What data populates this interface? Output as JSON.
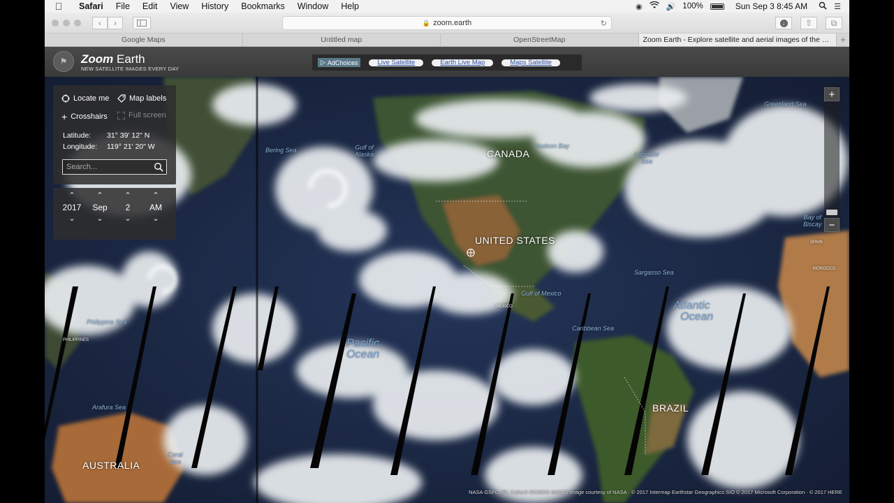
{
  "menubar": {
    "app_name": "Safari",
    "items": [
      "File",
      "Edit",
      "View",
      "History",
      "Bookmarks",
      "Window",
      "Help"
    ],
    "battery": "100%",
    "clock": "Sun Sep 3  8:45 AM"
  },
  "toolbar": {
    "url": "zoom.earth"
  },
  "tabs": [
    {
      "label": "Google Maps",
      "active": false
    },
    {
      "label": "Untitled map",
      "active": false
    },
    {
      "label": "OpenStreetMap",
      "active": false
    },
    {
      "label": "Zoom Earth - Explore satellite and aerial images of the Ear...",
      "active": true
    }
  ],
  "site": {
    "title_bold": "Zoom",
    "title_rest": " Earth",
    "tagline": "NEW SATELLITE IMAGES EVERY DAY"
  },
  "ads": {
    "choices_label": "AdChoices",
    "links": [
      "Live Satellite",
      "Earth Live Map",
      "Maps Satellite"
    ]
  },
  "panel": {
    "locate_label": "Locate me",
    "labels_label": "Map labels",
    "crosshairs_label": "Crosshairs",
    "fullscreen_label": "Full screen",
    "latitude_label": "Latitude:",
    "latitude_value": "31° 39' 12\" N",
    "longitude_label": "Longitude:",
    "longitude_value": "119° 21' 20\" W",
    "search_placeholder": "Search..."
  },
  "date": {
    "year": "2017",
    "month": "Sep",
    "day": "2",
    "period": "AM"
  },
  "map_labels": {
    "canada": "CANADA",
    "united_states": "UNITED STATES",
    "brazil": "BRAZIL",
    "australia": "AUSTRALIA",
    "pacific_line1": "Pacific",
    "pacific_line2": "Ocean",
    "atlantic_line1": "Atlantic",
    "atlantic_line2": "Ocean",
    "hudson_bay": "Hudson Bay",
    "labrador_sea_line1": "Labrador",
    "labrador_sea_line2": "Sea",
    "bering_sea": "Bering Sea",
    "gulf_of_alaska_line1": "Gulf of",
    "gulf_of_alaska_line2": "Alaska",
    "gulf_of_mexico": "Gulf of Mexico",
    "caribbean_sea": "Caribbean Sea",
    "sargasso_sea": "Sargasso Sea",
    "philippine_sea": "Philippine Sea",
    "arafura_sea": "Arafura Sea",
    "coral_sea_line1": "Coral",
    "coral_sea_line2": "Sea",
    "bay_of_biscay_line1": "Bay of",
    "bay_of_biscay_line2": "Biscay",
    "mexico": "MEXICO",
    "spain": "SPAIN",
    "morocco": "MOROCCO",
    "philippines": "PHILIPPINES",
    "greenland_sea": "Greenland Sea"
  },
  "zoom": {
    "plus": "+",
    "minus": "−"
  },
  "attribution": "NASA GSFC JPL Caltech EOSDIS MODIS Image courtesy of NASA · © 2017 Intermap Earthstar Geographics SIO © 2017 Microsoft Corporation · © 2017 HERE",
  "colors": {
    "ocean": "#1c2a4a",
    "cloud": "#e8ecef",
    "land_green": "#3f5a2c",
    "land_desert": "#9b6a3c",
    "ad_link_text": "#2f4f9f"
  }
}
